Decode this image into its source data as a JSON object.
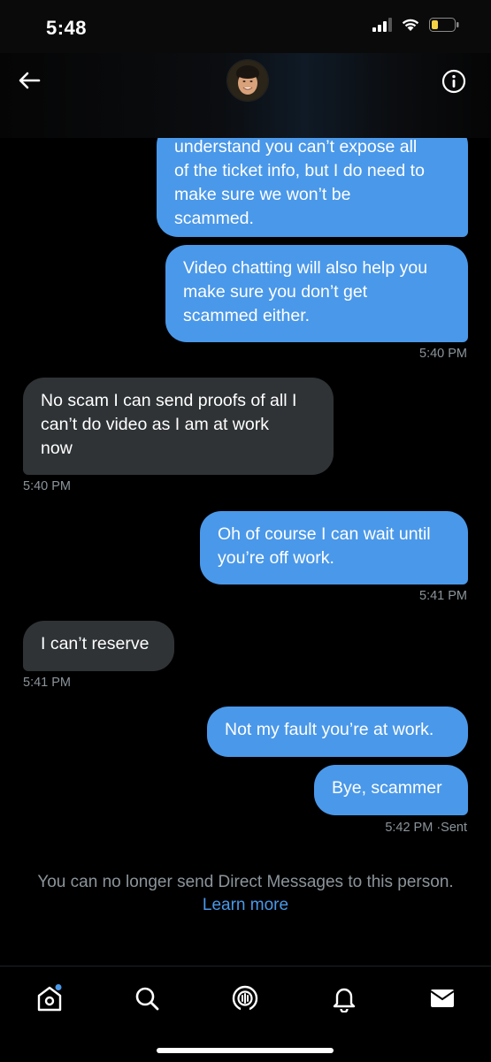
{
  "status": {
    "time": "5:48"
  },
  "header": {
    "back_icon": "arrow-left-icon",
    "info_icon": "info-icon"
  },
  "messages": [
    {
      "direction": "out",
      "lines": [
        "understand you can’t expose all",
        "of the ticket info, but I do need to",
        "make sure we won’t be",
        "scammed."
      ]
    },
    {
      "direction": "out",
      "lines": [
        "Video chatting will also help you",
        "make sure you don’t get",
        "scammed either."
      ],
      "time": "5:40 PM"
    },
    {
      "direction": "in",
      "lines": [
        "No scam I can send proofs of all I",
        "can’t do video as I am at work",
        "now"
      ],
      "time": "5:40 PM"
    },
    {
      "direction": "out",
      "lines": [
        "Oh of course I can wait until",
        "you’re off work."
      ],
      "time": "5:41 PM"
    },
    {
      "direction": "in",
      "lines": [
        "I can’t reserve"
      ],
      "time": "5:41 PM"
    },
    {
      "direction": "out",
      "lines": [
        "Not my fault you’re at work."
      ]
    },
    {
      "direction": "out",
      "lines": [
        "Bye, scammer"
      ],
      "time": "5:42 PM ·Sent"
    }
  ],
  "notice": {
    "text": "You can no longer send Direct Messages to this person.",
    "link": "Learn more"
  },
  "tabs": [
    {
      "name": "home",
      "icon": "home-icon"
    },
    {
      "name": "search",
      "icon": "search-icon"
    },
    {
      "name": "spaces",
      "icon": "spaces-icon"
    },
    {
      "name": "notifications",
      "icon": "bell-icon"
    },
    {
      "name": "messages",
      "icon": "envelope-icon"
    }
  ],
  "colors": {
    "outgoing_bubble": "#4a98e9",
    "incoming_bubble": "#2f3336",
    "link": "#4a98e9",
    "muted_text": "#8b949a"
  }
}
